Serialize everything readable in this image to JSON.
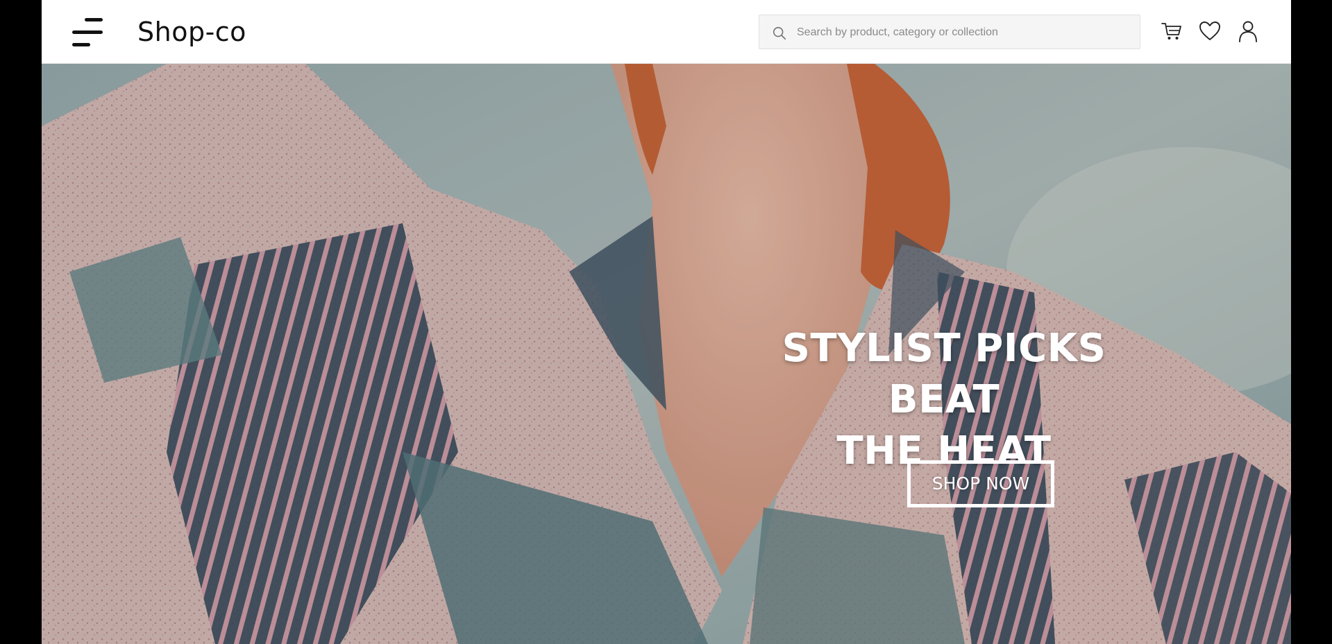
{
  "header": {
    "logo": "Shop-co",
    "search": {
      "placeholder": "Search by product, category or collection",
      "value": ""
    },
    "icons": [
      "menu-icon",
      "search-icon",
      "cart-icon",
      "heart-icon",
      "user-icon"
    ]
  },
  "hero": {
    "headline_line1": "STYLIST PICKS BEAT",
    "headline_line2": "THE HEAT",
    "cta_label": "SHOP NOW"
  },
  "colors": {
    "header_bg": "#ffffff",
    "text_dark": "#111111",
    "hero_text": "#ffffff",
    "outer_bg": "#000000"
  }
}
